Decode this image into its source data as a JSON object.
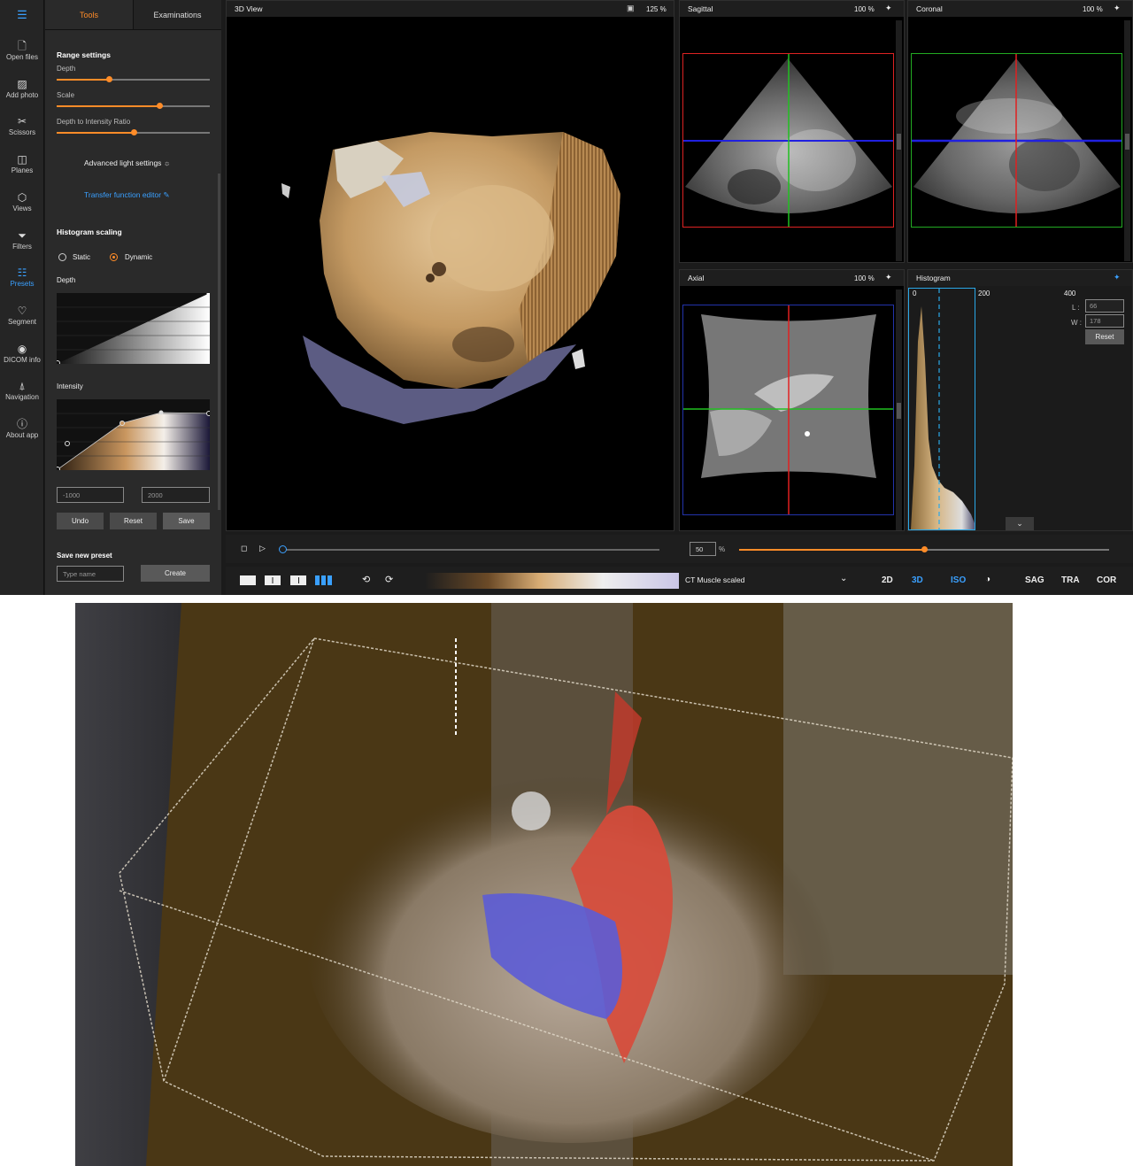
{
  "rail": {
    "items": [
      {
        "label": "Open files",
        "icon": "file-icon"
      },
      {
        "label": "Add photo",
        "icon": "photo-icon"
      },
      {
        "label": "Scissors",
        "icon": "scissors-icon"
      },
      {
        "label": "Planes",
        "icon": "planes-icon"
      },
      {
        "label": "Views",
        "icon": "cube-icon"
      },
      {
        "label": "Filters",
        "icon": "filter-icon"
      },
      {
        "label": "Presets",
        "icon": "sliders-icon"
      },
      {
        "label": "Segment",
        "icon": "heart-icon"
      },
      {
        "label": "DICOM info",
        "icon": "eye-icon"
      },
      {
        "label": "Navigation",
        "icon": "navigation-icon"
      },
      {
        "label": "About app",
        "icon": "info-icon"
      }
    ],
    "active_index": 6,
    "accent": "#3aa0ff"
  },
  "panel": {
    "tabs": [
      "Tools",
      "Examinations"
    ],
    "active_tab": "Tools",
    "range_settings": {
      "title": "Range settings",
      "depth": {
        "label": "Depth",
        "value": 0.34
      },
      "scale": {
        "label": "Scale",
        "value": 0.67
      },
      "ratio": {
        "label": "Depth to Intensity Ratio",
        "value": 0.5
      }
    },
    "advanced_light": "Advanced light settings",
    "transfer_function": "Transfer function editor",
    "histogram_scaling": {
      "title": "Histogram scaling",
      "options": [
        "Static",
        "Dynamic"
      ],
      "selected": "Dynamic"
    },
    "depth_label": "Depth",
    "intensity_label": "Intensity",
    "range_min": "-1000",
    "range_max": "2000",
    "buttons": {
      "undo": "Undo",
      "reset": "Reset",
      "save": "Save"
    },
    "save_preset": {
      "title": "Save new preset",
      "placeholder": "Type name",
      "create": "Create"
    },
    "accent": "#ff8c28"
  },
  "views": {
    "view3d": {
      "title": "3D View",
      "zoom": "125 %"
    },
    "sagittal": {
      "title": "Sagittal",
      "zoom": "100 %"
    },
    "coronal": {
      "title": "Coronal",
      "zoom": "100 %"
    },
    "axial": {
      "title": "Axial",
      "zoom": "100 %"
    },
    "histogram": {
      "title": "Histogram",
      "ticks": [
        "0",
        "200",
        "400"
      ],
      "l_label": "L :",
      "l_value": "66",
      "w_label": "W :",
      "w_value": "178",
      "reset": "Reset"
    }
  },
  "playbar": {
    "position": 0.0,
    "opacity_value": "50",
    "opacity_unit": "%",
    "opacity": 0.5
  },
  "toolbar": {
    "preset_name": "CT Muscle scaled",
    "modes": [
      "2D",
      "3D",
      "ISO",
      "SAG",
      "TRA",
      "COR"
    ],
    "active_modes": [
      "3D",
      "ISO"
    ]
  }
}
